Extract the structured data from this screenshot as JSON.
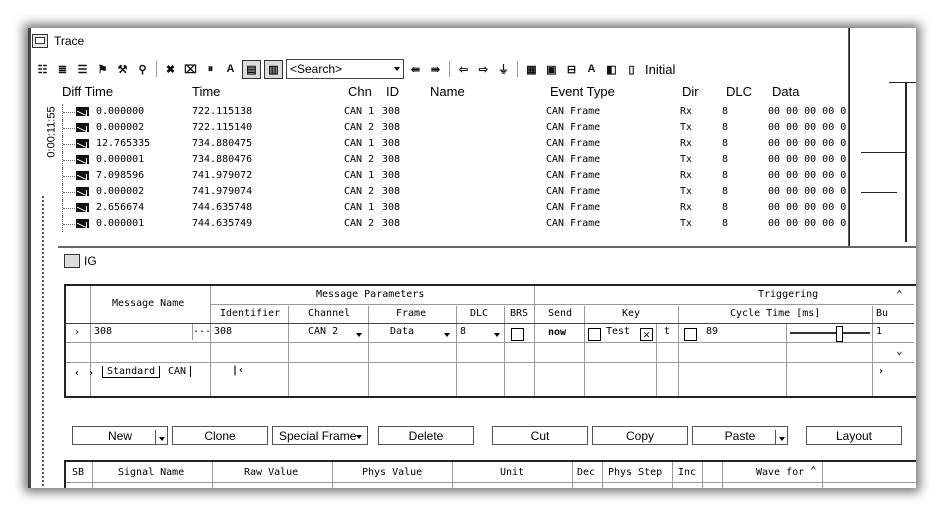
{
  "trace": {
    "title": "Trace",
    "search_placeholder": "<Search>",
    "initial_label": "Initial",
    "time_marker": "0:00:11:55",
    "columns": {
      "diff_time": "Diff Time",
      "time": "Time",
      "chn": "Chn",
      "id": "ID",
      "name": "Name",
      "event_type": "Event Type",
      "dir": "Dir",
      "dlc": "DLC",
      "data": "Data"
    },
    "rows": [
      {
        "diff": "0.000000",
        "time": "722.115138",
        "chn": "CAN 1",
        "id": "308",
        "event": "CAN Frame",
        "dir": "Rx",
        "dlc": "8",
        "data": "00 00 00 00 0"
      },
      {
        "diff": "0.000002",
        "time": "722.115140",
        "chn": "CAN 2",
        "id": "308",
        "event": "CAN Frame",
        "dir": "Tx",
        "dlc": "8",
        "data": "00 00 00 00 0"
      },
      {
        "diff": "12.765335",
        "time": "734.880475",
        "chn": "CAN 1",
        "id": "308",
        "event": "CAN Frame",
        "dir": "Rx",
        "dlc": "8",
        "data": "00 00 00 00 0"
      },
      {
        "diff": "0.000001",
        "time": "734.880476",
        "chn": "CAN 2",
        "id": "308",
        "event": "CAN Frame",
        "dir": "Tx",
        "dlc": "8",
        "data": "00 00 00 00 0"
      },
      {
        "diff": "7.098596",
        "time": "741.979072",
        "chn": "CAN 1",
        "id": "308",
        "event": "CAN Frame",
        "dir": "Rx",
        "dlc": "8",
        "data": "00 00 00 00 0"
      },
      {
        "diff": "0.000002",
        "time": "741.979074",
        "chn": "CAN 2",
        "id": "308",
        "event": "CAN Frame",
        "dir": "Tx",
        "dlc": "8",
        "data": "00 00 00 00 0"
      },
      {
        "diff": "2.656674",
        "time": "744.635748",
        "chn": "CAN 1",
        "id": "308",
        "event": "CAN Frame",
        "dir": "Rx",
        "dlc": "8",
        "data": "00 00 00 00 0"
      },
      {
        "diff": "0.000001",
        "time": "744.635749",
        "chn": "CAN 2",
        "id": "308",
        "event": "CAN Frame",
        "dir": "Tx",
        "dlc": "8",
        "data": "00 00 00 00 0"
      }
    ]
  },
  "ig": {
    "title": "IG",
    "group_headers": {
      "message_params": "Message Parameters",
      "triggering": "Triggering"
    },
    "headers": {
      "message_name": "Message Name",
      "identifier": "Identifier",
      "channel": "Channel",
      "frame": "Frame",
      "dlc": "DLC",
      "brs": "BRS",
      "send": "Send",
      "key": "Key",
      "cycle_time": "Cycle Time [ms]",
      "burst": "Bu"
    },
    "row": {
      "message_name": "308",
      "ellipsis": "...",
      "identifier": "308",
      "channel": "CAN 2",
      "frame": "Data",
      "dlc": "8",
      "send": "now",
      "key": "Test",
      "key_t": "t",
      "cycle_time": "89",
      "burst": "1"
    },
    "tabs": [
      "Standard",
      "CAN"
    ],
    "buttons": {
      "new": "New",
      "clone": "Clone",
      "special_frame": "Special Frame",
      "delete": "Delete",
      "cut": "Cut",
      "copy": "Copy",
      "paste": "Paste",
      "layout": "Layout"
    },
    "signal_headers": {
      "sb": "SB",
      "signal_name": "Signal Name",
      "raw_value": "Raw Value",
      "phys_value": "Phys Value",
      "unit": "Unit",
      "dec": "Dec",
      "phys_step": "Phys Step",
      "inc": "Inc",
      "wave_form": "Wave for"
    }
  }
}
